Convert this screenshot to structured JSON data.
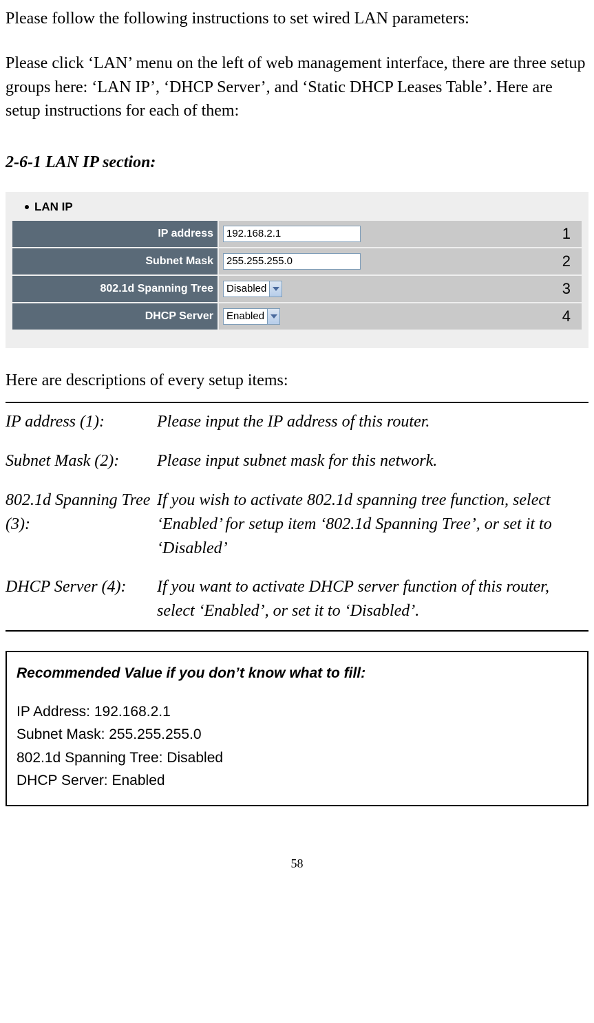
{
  "intro": {
    "line1": "Please follow the following instructions to set wired LAN parameters:",
    "line2": "Please click ‘LAN’ menu on the left of web management interface, there are three setup groups here: ‘LAN IP’, ‘DHCP Server’, and ‘Static DHCP Leases Table’. Here are setup instructions for each of them:"
  },
  "section_heading": "2-6-1 LAN IP section:",
  "lanip": {
    "title": "LAN IP",
    "rows": [
      {
        "label": "IP address",
        "type": "text",
        "value": "192.168.2.1",
        "num": "1"
      },
      {
        "label": "Subnet Mask",
        "type": "text",
        "value": "255.255.255.0",
        "num": "2"
      },
      {
        "label": "802.1d Spanning Tree",
        "type": "select",
        "value": "Disabled",
        "num": "3"
      },
      {
        "label": "DHCP Server",
        "type": "select",
        "value": "Enabled",
        "num": "4"
      }
    ]
  },
  "desc_intro": "Here are descriptions of every setup items:",
  "descriptions": [
    {
      "term": "IP address (1):",
      "text": "Please input the IP address of this router."
    },
    {
      "term": "Subnet Mask (2):",
      "text": "Please input subnet mask for this network."
    },
    {
      "term": "802.1d Spanning Tree (3):",
      "text": "If you wish to activate 802.1d spanning tree function, select ‘Enabled’ for setup item ‘802.1d Spanning Tree’, or set it to ‘Disabled’"
    },
    {
      "term": "DHCP Server (4):",
      "text": "If you want to activate DHCP server function of this router, select ‘Enabled’, or set it to ‘Disabled’."
    }
  ],
  "recommended": {
    "title": "Recommended Value if you don’t know what to fill:",
    "lines": [
      "IP Address: 192.168.2.1",
      "Subnet Mask: 255.255.255.0",
      "802.1d Spanning Tree: Disabled",
      "DHCP Server: Enabled"
    ]
  },
  "page_number": "58"
}
